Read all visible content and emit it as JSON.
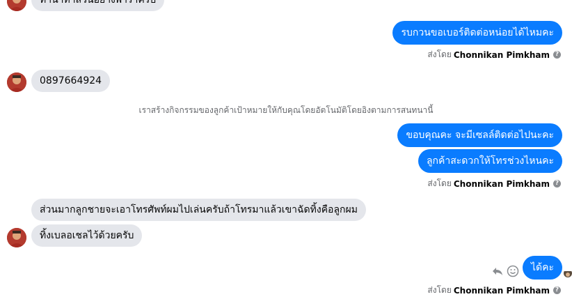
{
  "messages": {
    "top_partial": "ทำนาทำสวนอย่างพาราครับ",
    "out1": "รบกวนขอเบอร์ติดต่อหน่อยได้ไหมคะ",
    "phone": "0897664924",
    "system_note": "เราสร้างกิจกรรมของลูกค้าเป้าหมายให้กับคุณโดยอัตโนมัติโดยอิงตามการสนทนานี้",
    "out2": "ขอบคุณคะ จะมีเซลล์ติดต่อไปนะคะ",
    "out3": "ลูกค้าสะดวกให้โทรช่วงไหนคะ",
    "in1": "ส่วนมากลูกชายจะเอาโทรศัพท์ผมไปเล่นครับถ้าโทรมาแล้วเขาฉัดทิ้งคือลูกผม",
    "in2": "ทิ้งเบลอเชลไว้ด้วยครับ",
    "out4": "ได้คะ"
  },
  "sent_by": {
    "prefix": "ส่งโดย",
    "name": "Chonnikan Pimkham",
    "help": "?"
  },
  "colors": {
    "outgoing_bubble": "#0a7cff",
    "incoming_bubble": "#e4e6eb"
  },
  "icons": [
    "reply-icon",
    "emoji-icon",
    "help-icon",
    "seen-avatar"
  ]
}
